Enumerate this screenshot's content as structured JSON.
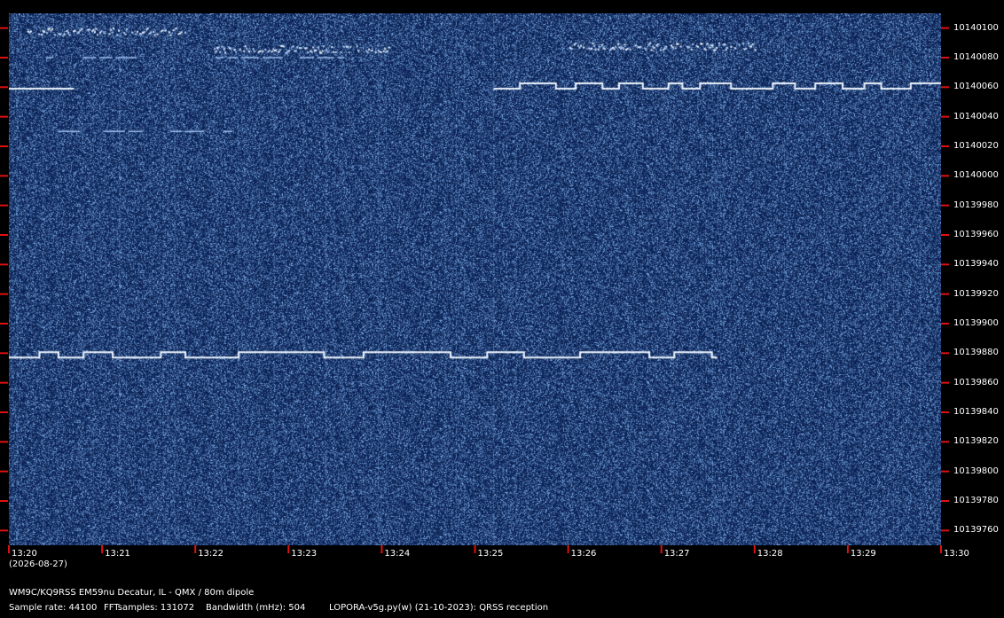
{
  "colors": {
    "background": "#000000",
    "plot_bg": "#0c2a5c",
    "tick": "#e01010",
    "signal": "#f0f8ff",
    "noise": "#4a7ab8"
  },
  "frequency_axis": {
    "labels": [
      "10140100",
      "10140080",
      "10140060",
      "10140040",
      "10140020",
      "10140000",
      "10139980",
      "10139960",
      "10139940",
      "10139920",
      "10139900",
      "10139880",
      "10139860",
      "10139840",
      "10139820",
      "10139800",
      "10139780",
      "10139760"
    ]
  },
  "time_axis": {
    "labels": [
      "13:20",
      "13:21",
      "13:22",
      "13:23",
      "13:24",
      "13:25",
      "13:26",
      "13:27",
      "13:28",
      "13:29",
      "13:30"
    ],
    "date": "(2026-08-27)"
  },
  "footer": {
    "station": "WM9C/KQ9RSS EM59nu Decatur, IL - QMX / 80m dipole",
    "sample_rate": "Sample rate: 44100",
    "fft_samples": "FFTsamples: 131072",
    "bandwidth": "Bandwidth (mHz): 504",
    "software": "LOPORA-v5g.py(w) (21-10-2023): QRSS reception"
  },
  "signals": [
    {
      "name": "fsk-trace-main",
      "freq_hz": 10139877,
      "start": "13:20",
      "end": "13:27.6",
      "type": "fsk"
    },
    {
      "name": "fsk-trace-upper-left",
      "freq_hz": 10140059,
      "start": "13:20",
      "end": "13:20.7",
      "type": "fsk"
    },
    {
      "name": "fsk-trace-upper-right",
      "freq_hz": 10140059,
      "start": "13:25.2",
      "end": "13:30",
      "type": "fsk"
    },
    {
      "name": "cw-burst-top-left",
      "freq_hz": 10140098,
      "start": "13:20.2",
      "end": "13:21.9",
      "type": "burst"
    },
    {
      "name": "cw-burst-mid-left",
      "freq_hz": 10140086,
      "start": "13:22.2",
      "end": "13:24.1",
      "type": "burst"
    },
    {
      "name": "cw-burst-top-right",
      "freq_hz": 10140088,
      "start": "13:26",
      "end": "13:28.0",
      "type": "burst"
    },
    {
      "name": "faint-trace-80",
      "freq_hz": 10140080,
      "start": "13:20.3",
      "end": "13:23.6",
      "type": "faint"
    },
    {
      "name": "faint-trace-30",
      "freq_hz": 10140030,
      "start": "13:20.3",
      "end": "13:22.4",
      "type": "faint"
    }
  ]
}
